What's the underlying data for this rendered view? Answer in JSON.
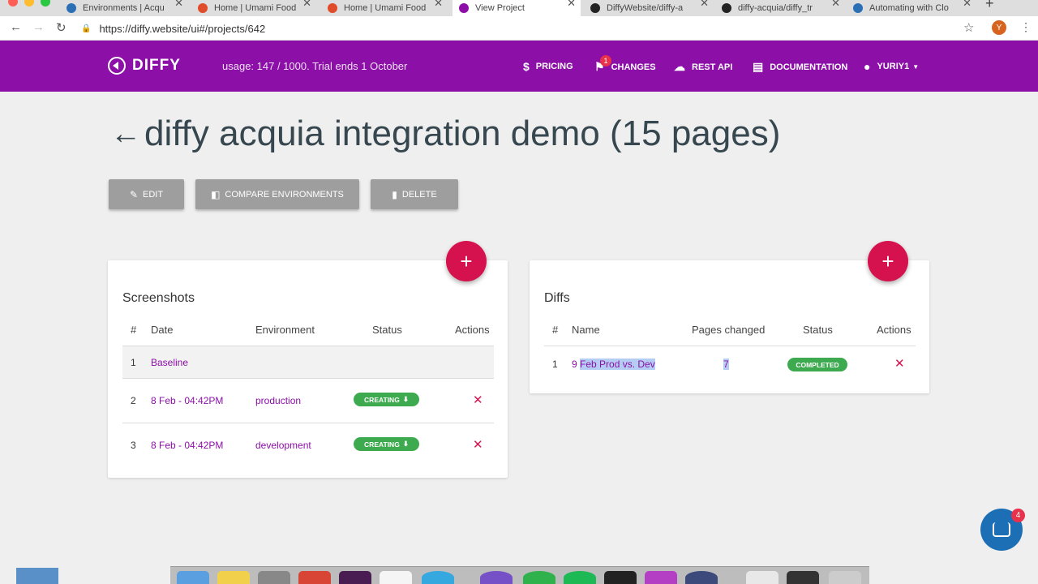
{
  "browser": {
    "tabs": [
      {
        "title": "Environments | Acqu",
        "color": "#2b6fb5"
      },
      {
        "title": "Home | Umami Food",
        "color": "#e04b2a"
      },
      {
        "title": "Home | Umami Food",
        "color": "#e04b2a"
      },
      {
        "title": "View Project",
        "color": "#8c0fa8"
      },
      {
        "title": "DiffyWebsite/diffy-a",
        "color": "#222222"
      },
      {
        "title": "diffy-acquia/diffy_tr",
        "color": "#222222"
      },
      {
        "title": "Automating with Clo",
        "color": "#2b6fb5"
      }
    ],
    "url": "https://diffy.website/ui#/projects/642",
    "profile_initial": "Y"
  },
  "header": {
    "logo": "DIFFY",
    "usage": "usage: 147 / 1000. Trial ends 1 October",
    "nav": {
      "pricing": "PRICING",
      "changes": "CHANGES",
      "changes_badge": "1",
      "rest_api": "REST API",
      "documentation": "DOCUMENTATION",
      "user": "YURIY1"
    }
  },
  "page": {
    "title": "diffy acquia integration demo (15 pages)",
    "buttons": {
      "edit": "EDIT",
      "compare": "COMPARE ENVIRONMENTS",
      "delete": "DELETE"
    }
  },
  "screenshots": {
    "title": "Screenshots",
    "columns": [
      "#",
      "Date",
      "Environment",
      "Status",
      "Actions"
    ],
    "rows": [
      {
        "num": "1",
        "date": "Baseline",
        "env": "",
        "status": ""
      },
      {
        "num": "2",
        "date": "8 Feb - 04:42PM",
        "env": "production",
        "status": "CREATING"
      },
      {
        "num": "3",
        "date": "8 Feb - 04:42PM",
        "env": "development",
        "status": "CREATING"
      }
    ]
  },
  "diffs": {
    "title": "Diffs",
    "columns": [
      "#",
      "Name",
      "Pages changed",
      "Status",
      "Actions"
    ],
    "rows": [
      {
        "num": "1",
        "name_prefix": "9",
        "name_selected": "Feb Prod vs. Dev",
        "pages_changed": "7",
        "status": "COMPLETED"
      }
    ]
  },
  "chat": {
    "badge": "4"
  },
  "colors": {
    "brand": "#8c0fa8",
    "accent": "#d5124e",
    "success": "#3daa4f"
  }
}
